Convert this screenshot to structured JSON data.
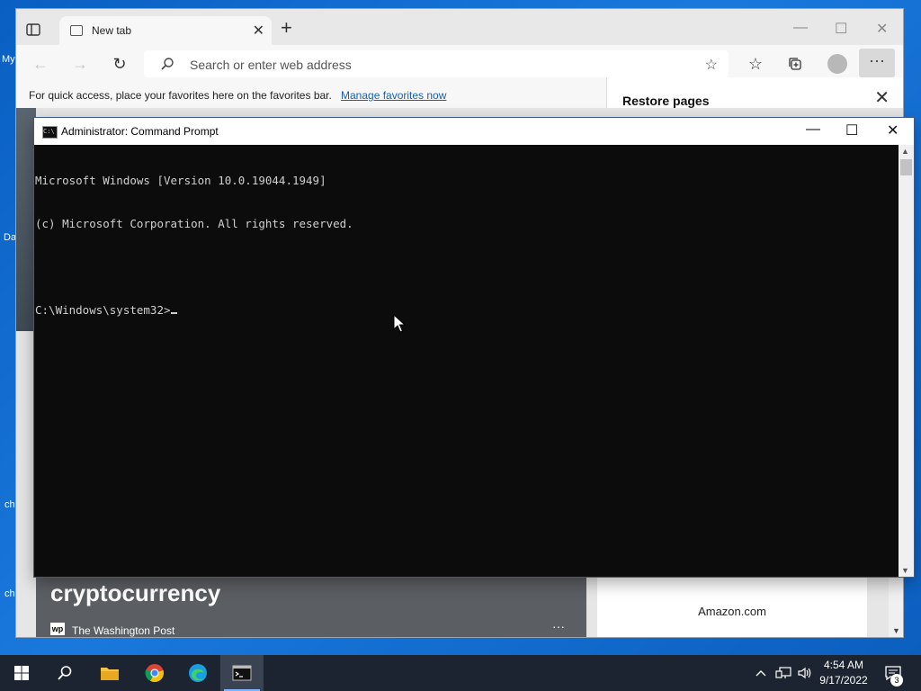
{
  "desktop": {
    "side_labels": [
      "My",
      "Da",
      "ch",
      "ch"
    ]
  },
  "browser": {
    "tab_title": "New tab",
    "address_placeholder": "Search or enter web address",
    "favorites_message": "For quick access, place your favorites here on the favorites bar.",
    "manage_favorites_link": "Manage favorites now",
    "restore_title": "Restore pages",
    "news_headline": "cryptocurrency",
    "news_source": "The Washington Post",
    "news_source_icon": "wp",
    "news_more": "···",
    "amazon_label": "Amazon.com"
  },
  "cmd": {
    "title": "Administrator: Command Prompt",
    "icon_text": "C:\\",
    "lines": [
      "Microsoft Windows [Version 10.0.19044.1949]",
      "(c) Microsoft Corporation. All rights reserved.",
      "",
      "C:\\Windows\\system32>"
    ]
  },
  "taskbar": {
    "time": "4:54 AM",
    "date": "9/17/2022",
    "notification_count": "3"
  }
}
